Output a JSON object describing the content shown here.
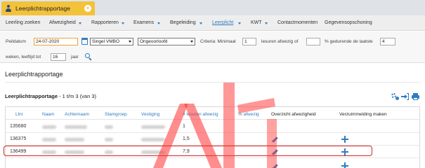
{
  "tab": {
    "title": "Leerplichtrapportage",
    "close_icon": "close-icon",
    "user_icon": "user-icon"
  },
  "menu": {
    "items": [
      {
        "label": "Leerling zoeken",
        "has_caret": false,
        "active": false
      },
      {
        "label": "Afwezigheid",
        "has_caret": true,
        "active": false
      },
      {
        "label": "Rapporteren",
        "has_caret": true,
        "active": false
      },
      {
        "label": "Examens",
        "has_caret": true,
        "active": false
      },
      {
        "label": "Begeleiding",
        "has_caret": true,
        "active": false
      },
      {
        "label": "Leerplicht",
        "has_caret": true,
        "active": true
      },
      {
        "label": "KWT",
        "has_caret": true,
        "active": false
      },
      {
        "label": "Contactmomenten",
        "has_caret": false,
        "active": false
      },
      {
        "label": "Gegevensopschoning",
        "has_caret": false,
        "active": false
      }
    ]
  },
  "filters": {
    "peildatum_label": "Peildatum",
    "peildatum_value": "24-07-2020",
    "groep_select": "Singel VMBO",
    "reden_select": "Ongeoorloofd",
    "criteria_label": "Criteria: Minimaal",
    "minimaal_value": "1",
    "lesuren_label": "lesuren afwezig of",
    "percentage_value": "",
    "percentage_label": "% gedurende de laatste",
    "weken_value": "4",
    "weken_label": "weken, leeftijd tot",
    "leeftijd_value": "16",
    "jaar_label": "jaar"
  },
  "content": {
    "page_title": "Leerplichtrapportage",
    "section_title": "Leerplichtrapportage",
    "section_count": " - 1 t/m 3 (van 3)"
  },
  "table": {
    "columns": [
      "Llnr",
      "Naam",
      "Achternaam",
      "Stamgroep",
      "Vestiging",
      "# lesuren afwezig",
      "% afwezig",
      "Overzicht afwezigheid",
      "Verzuimmelding maken"
    ],
    "rows": [
      {
        "llnr": "135680",
        "lesuren": "1"
      },
      {
        "llnr": "136375",
        "lesuren": "1,5"
      },
      {
        "llnr": "136499",
        "lesuren": "7,9",
        "highlighted": true
      }
    ]
  },
  "colors": {
    "accent": "#2f7cc2",
    "tab_active": "#f3c23b",
    "highlight_border": "#d42525",
    "watermark": "#ff3030"
  }
}
